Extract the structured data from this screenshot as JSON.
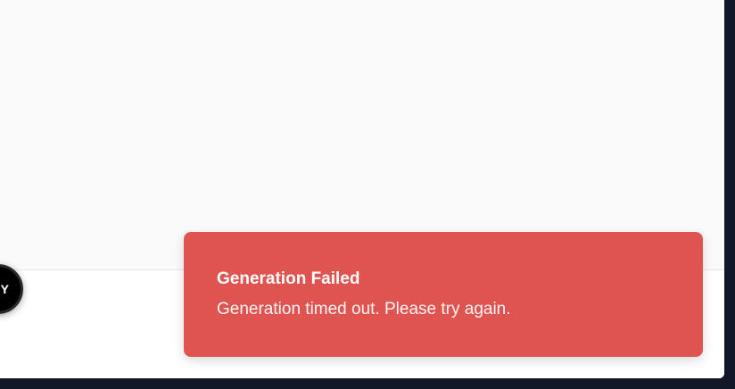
{
  "floating_button": {
    "label": "Y"
  },
  "toast": {
    "title": "Generation Failed",
    "message": "Generation timed out. Please try again."
  },
  "colors": {
    "toast_background": "#df5450",
    "page_background": "#fafafa",
    "outer_background": "#111827"
  }
}
